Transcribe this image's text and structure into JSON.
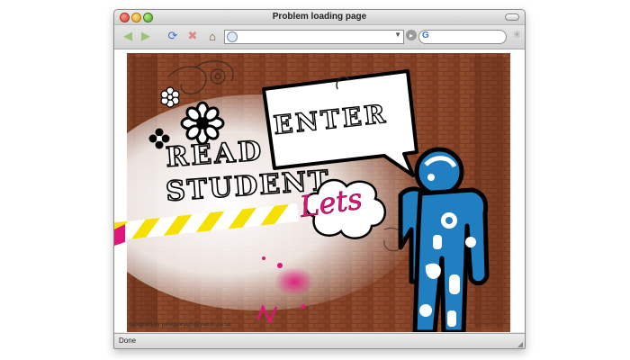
{
  "window": {
    "title": "Problem loading page"
  },
  "toolbar": {
    "url_value": "",
    "search_value": ""
  },
  "page": {
    "headline_read": "READ",
    "headline_student": "STUDENT",
    "bubble_text": "ENTER",
    "script_text": "Lets",
    "credit": "designed by petegdesign@yahoo.co.uk"
  },
  "status": {
    "text": "Done"
  },
  "colors": {
    "accent_pink": "#e0147a",
    "figure_blue": "#1f7fc0",
    "stripe_yellow": "#f5e000",
    "brick": "#7a3a22"
  }
}
